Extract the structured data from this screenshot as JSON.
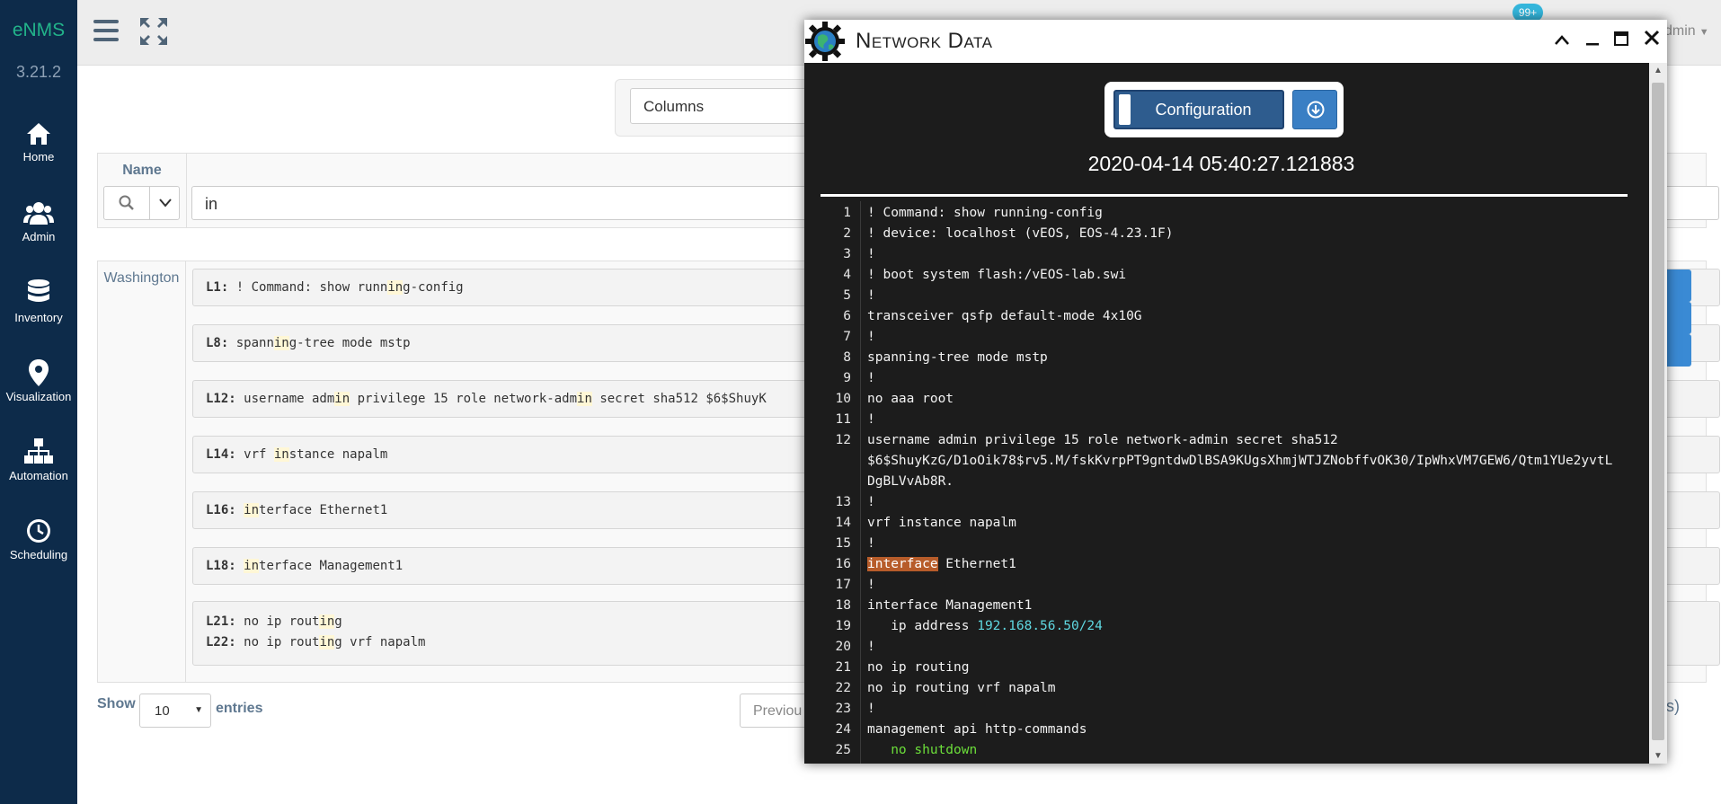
{
  "sidebar": {
    "brand": "eNMS",
    "version": "3.21.2",
    "items": [
      {
        "label": "Home",
        "icon": "home-icon"
      },
      {
        "label": "Admin",
        "icon": "users-icon"
      },
      {
        "label": "Inventory",
        "icon": "database-icon"
      },
      {
        "label": "Visualization",
        "icon": "map-marker-icon"
      },
      {
        "label": "Automation",
        "icon": "sitemap-icon"
      },
      {
        "label": "Scheduling",
        "icon": "clock-icon"
      }
    ]
  },
  "topbar": {
    "notification_badge": "99+",
    "user_fragment": "dmin"
  },
  "table": {
    "columns_label": "Columns",
    "name_header": "Name",
    "filter_value": "in",
    "device": "Washington",
    "results": [
      {
        "lines": [
          {
            "num": "L1:",
            "pre": " ! Command: show runn",
            "hl": "in",
            "post": "g-config"
          }
        ]
      },
      {
        "lines": [
          {
            "num": "L8:",
            "pre": " spann",
            "hl": "in",
            "post": "g-tree mode mstp"
          }
        ]
      },
      {
        "lines": [
          {
            "num": "L12:",
            "pre": " username adm",
            "hl": "in",
            "post": " privilege 15 role network-adm",
            "hl2": "in",
            "post2": " secret sha512 $6$ShuyK"
          }
        ]
      },
      {
        "lines": [
          {
            "num": "L14:",
            "pre": " vrf ",
            "hl": "in",
            "post": "stance napalm"
          }
        ]
      },
      {
        "lines": [
          {
            "num": "L16:",
            "pre": " ",
            "hl": "in",
            "post": "terface Ethernet1"
          }
        ]
      },
      {
        "lines": [
          {
            "num": "L18:",
            "pre": " ",
            "hl": "in",
            "post": "terface Management1"
          }
        ]
      },
      {
        "lines": [
          {
            "num": "L21:",
            "pre": " no ip rout",
            "hl": "in",
            "post": "g"
          },
          {
            "num": "L22:",
            "pre": " no ip rout",
            "hl": "in",
            "post": "g vrf napalm"
          }
        ]
      }
    ],
    "show_label": "Show",
    "page_size": "10",
    "entries_label": "entries",
    "previous_label": "Previou",
    "entries_tail": "ies)"
  },
  "panel": {
    "title": "Network Data",
    "toggle_label": "Configuration",
    "download_icon": "download-icon",
    "timestamp": "2020-04-14 05:40:27.121883",
    "config_lines": [
      {
        "n": "1",
        "t": "! Command: show running-config"
      },
      {
        "n": "2",
        "t": "! device: localhost (vEOS, EOS-4.23.1F)"
      },
      {
        "n": "3",
        "t": "!"
      },
      {
        "n": "4",
        "t": "! boot system flash:/vEOS-lab.swi"
      },
      {
        "n": "5",
        "t": "!"
      },
      {
        "n": "6",
        "t": "transceiver qsfp default-mode 4x10G"
      },
      {
        "n": "7",
        "t": "!"
      },
      {
        "n": "8",
        "t": "spanning-tree mode mstp"
      },
      {
        "n": "9",
        "t": "!"
      },
      {
        "n": "10",
        "t": "no aaa root"
      },
      {
        "n": "11",
        "t": "!"
      },
      {
        "n": "12",
        "t": "username admin privilege 15 role network-admin secret sha512"
      },
      {
        "n": "",
        "t": "$6$ShuyKzG/D1oOik78$rv5.M/fskKvrpPT9gntdwDlBSA9KUgsXhmjWTJZNobffvOK30/IpWhxVM7GEW6/Qtm1YUe2yvtL"
      },
      {
        "n": "",
        "t": "DgBLVvAb8R."
      },
      {
        "n": "13",
        "t": "!"
      },
      {
        "n": "14",
        "t": "vrf instance napalm"
      },
      {
        "n": "15",
        "t": "!"
      },
      {
        "n": "16",
        "t": "interface",
        "sel": true,
        "rest": " Ethernet1"
      },
      {
        "n": "17",
        "t": "!"
      },
      {
        "n": "18",
        "t": "interface Management1"
      },
      {
        "n": "19",
        "t": "   ip address ",
        "ip": "192.168.56.50/24"
      },
      {
        "n": "20",
        "t": "!"
      },
      {
        "n": "21",
        "t": "no ip routing"
      },
      {
        "n": "22",
        "t": "no ip routing vrf napalm"
      },
      {
        "n": "23",
        "t": "!"
      },
      {
        "n": "24",
        "t": "management api http-commands"
      },
      {
        "n": "25",
        "t": "   ",
        "green": "no shutdown"
      }
    ]
  },
  "colors": {
    "sidebar_bg": "#0d2b4a",
    "brand": "#22b38a",
    "toggle_bg": "#2e5c8e",
    "selection": "#b75c2a",
    "ip_text": "#5fd7e0",
    "green_text": "#6cdf3a"
  }
}
